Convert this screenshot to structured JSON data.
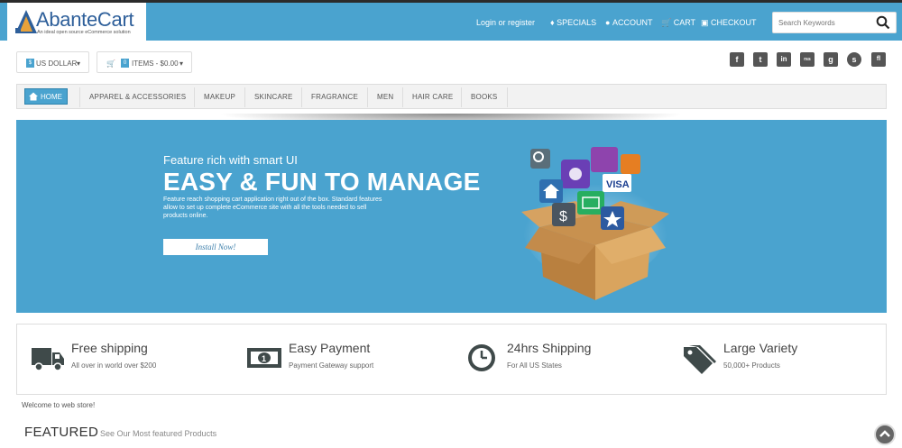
{
  "header": {
    "logo_text": "AbanteCart",
    "logo_tagline": "An ideal open source eCommerce solution",
    "links": {
      "login": "Login or register",
      "specials": "SPECIALS",
      "account": "ACCOUNT",
      "cart": "CART",
      "checkout": "CHECKOUT"
    },
    "search": {
      "placeholder": "Search Keywords"
    }
  },
  "toolbar": {
    "currency_badge": "$",
    "currency_label": "US DOLLAR",
    "cart_badge": "0",
    "cart_label": "ITEMS - $0.00",
    "social": [
      "f",
      "t",
      "in",
      "rss",
      "g",
      "s",
      "fl"
    ]
  },
  "nav": {
    "home": "HOME",
    "items": [
      "APPAREL & ACCESSORIES",
      "MAKEUP",
      "SKINCARE",
      "FRAGRANCE",
      "MEN",
      "HAIR CARE",
      "BOOKS"
    ]
  },
  "banner": {
    "subtitle": "Feature rich with smart UI",
    "title": "EASY & FUN TO MANAGE",
    "description": "Feature reach shopping cart application right out of the box. Standard features allow to set up complete eCommerce site with all the tools needed to sell products online.",
    "button": "Install Now!",
    "visa_label": "VISA"
  },
  "features": [
    {
      "title": "Free shipping",
      "subtitle": "All over in world over $200",
      "icon": "truck-icon"
    },
    {
      "title": "Easy Payment",
      "subtitle": "Payment Gateway support",
      "icon": "banknote-icon"
    },
    {
      "title": "24hrs Shipping",
      "subtitle": "For All US States",
      "icon": "clock-icon"
    },
    {
      "title": "Large Variety",
      "subtitle": "50,000+ Products",
      "icon": "tags-icon"
    }
  ],
  "welcome": "Welcome to web store!",
  "featured": {
    "heading": "FEATURED",
    "subheading": "See Our Most featured Products"
  },
  "colors": {
    "brand_blue": "#4aa3cf",
    "logo_blue": "#2e5f9a",
    "dark_icon": "#3f4a4a"
  }
}
